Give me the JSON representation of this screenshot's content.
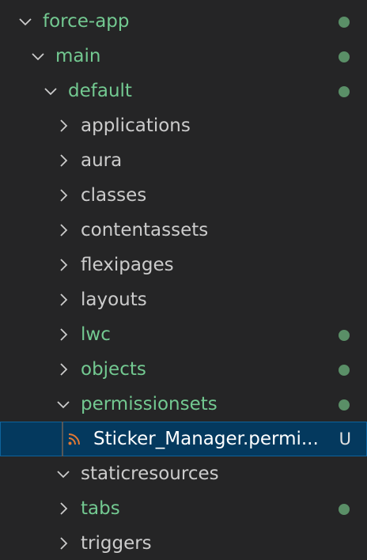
{
  "explorer": {
    "items": [
      {
        "label": "force-app",
        "expanded": true,
        "modified": true
      },
      {
        "label": "main",
        "expanded": true,
        "modified": true
      },
      {
        "label": "default",
        "expanded": true,
        "modified": true
      },
      {
        "label": "applications",
        "expanded": false,
        "modified": false
      },
      {
        "label": "aura",
        "expanded": false,
        "modified": false
      },
      {
        "label": "classes",
        "expanded": false,
        "modified": false
      },
      {
        "label": "contentassets",
        "expanded": false,
        "modified": false
      },
      {
        "label": "flexipages",
        "expanded": false,
        "modified": false
      },
      {
        "label": "layouts",
        "expanded": false,
        "modified": false
      },
      {
        "label": "lwc",
        "expanded": false,
        "modified": true
      },
      {
        "label": "objects",
        "expanded": false,
        "modified": true
      },
      {
        "label": "permissionsets",
        "expanded": true,
        "modified": true
      },
      {
        "label": "Sticker_Manager.permi...",
        "selected": true,
        "status": "U",
        "icon": "rss-icon"
      },
      {
        "label": "staticresources",
        "expanded": true,
        "modified": false
      },
      {
        "label": "tabs",
        "expanded": false,
        "modified": true
      },
      {
        "label": "triggers",
        "expanded": false,
        "modified": false
      }
    ]
  },
  "colors": {
    "background": "#252526",
    "selected_background": "#04395e",
    "modified_text": "#73c991",
    "default_text": "#cccccc",
    "modified_dot": "#5a8f67",
    "rss_icon": "#e37933"
  }
}
